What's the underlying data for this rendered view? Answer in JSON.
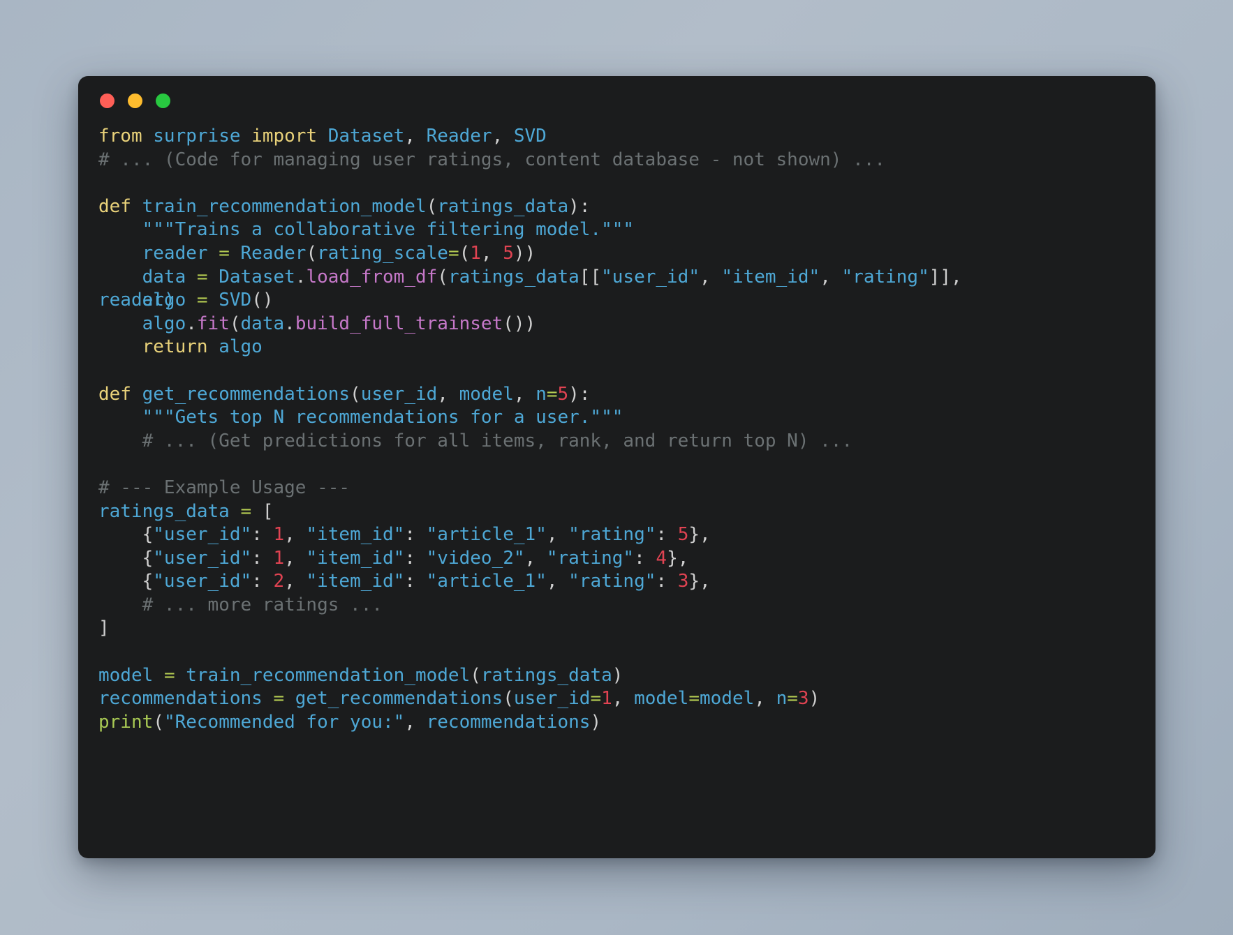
{
  "window": {
    "kind": "code-editor-window",
    "background_color": "#1b1c1d",
    "page_background": "#aab7c5",
    "traffic_lights": [
      {
        "name": "close",
        "label": "Close",
        "color": "#ff5f57"
      },
      {
        "name": "minimize",
        "label": "Minimize",
        "color": "#febc2e"
      },
      {
        "name": "maximize",
        "label": "Maximize",
        "color": "#28c840"
      }
    ]
  },
  "theme": {
    "keyword": "#e9d27a",
    "identifier": "#4ea8d6",
    "function": "#c678c9",
    "number": "#e04352",
    "string": "#4ea8d6",
    "comment": "#6b7173",
    "operator": "#b5cc52",
    "punctuation": "#d0d0d0",
    "builtin": "#a8c954"
  },
  "code": {
    "language": "python",
    "lines": [
      {
        "id": "l1",
        "text": "from surprise import Dataset, Reader, SVD"
      },
      {
        "id": "l2",
        "text": "# ... (Code for managing user ratings, content database - not shown) ..."
      },
      {
        "id": "l3",
        "text": ""
      },
      {
        "id": "l4",
        "text": "def train_recommendation_model(ratings_data):"
      },
      {
        "id": "l5",
        "text": "    \"\"\"Trains a collaborative filtering model.\"\"\""
      },
      {
        "id": "l6",
        "text": "    reader = Reader(rating_scale=(1, 5))"
      },
      {
        "id": "l7",
        "text": "    data = Dataset.load_from_df(ratings_data[[\"user_id\", \"item_id\", \"rating\"]], reader)"
      },
      {
        "id": "l8",
        "text": "    algo = SVD()"
      },
      {
        "id": "l9",
        "text": "    algo.fit(data.build_full_trainset())"
      },
      {
        "id": "l10",
        "text": "    return algo"
      },
      {
        "id": "l11",
        "text": ""
      },
      {
        "id": "l12",
        "text": "def get_recommendations(user_id, model, n=5):"
      },
      {
        "id": "l13",
        "text": "    \"\"\"Gets top N recommendations for a user.\"\"\""
      },
      {
        "id": "l14",
        "text": "    # ... (Get predictions for all items, rank, and return top N) ..."
      },
      {
        "id": "l15",
        "text": ""
      },
      {
        "id": "l16",
        "text": "# --- Example Usage ---"
      },
      {
        "id": "l17",
        "text": "ratings_data = ["
      },
      {
        "id": "l18",
        "text": "    {\"user_id\": 1, \"item_id\": \"article_1\", \"rating\": 5},"
      },
      {
        "id": "l19",
        "text": "    {\"user_id\": 1, \"item_id\": \"video_2\", \"rating\": 4},"
      },
      {
        "id": "l20",
        "text": "    {\"user_id\": 2, \"item_id\": \"article_1\", \"rating\": 3},"
      },
      {
        "id": "l21",
        "text": "    # ... more ratings ..."
      },
      {
        "id": "l22",
        "text": "]"
      },
      {
        "id": "l23",
        "text": ""
      },
      {
        "id": "l24",
        "text": "model = train_recommendation_model(ratings_data)"
      },
      {
        "id": "l25",
        "text": "recommendations = get_recommendations(user_id=1, model=model, n=3)"
      },
      {
        "id": "l26",
        "text": "print(\"Recommended for you:\", recommendations)"
      }
    ],
    "tokens": {
      "kw_from": "from",
      "mod_surprise": "surprise",
      "kw_import": "import",
      "imp_dataset": "Dataset",
      "imp_reader": "Reader",
      "imp_svd": "SVD",
      "comment_managing": "# ... (Code for managing user ratings, content database - not shown) ...",
      "kw_def": "def",
      "fn_train": "train_recommendation_model",
      "arg_ratings_data": "ratings_data",
      "doc_trains": "\"\"\"Trains a collaborative filtering model.\"\"\"",
      "var_reader": "reader",
      "cls_reader": "Reader",
      "kwarg_rating_scale": "rating_scale",
      "num_1": "1",
      "num_5": "5",
      "var_data": "data",
      "cls_dataset": "Dataset",
      "meth_load_from_df": "load_from_df",
      "str_user_id": "\"user_id\"",
      "str_item_id": "\"item_id\"",
      "str_rating": "\"rating\"",
      "wrap_reader": "reader)",
      "var_algo": "algo",
      "cls_svd": "SVD",
      "meth_fit": "fit",
      "meth_build_full_trainset": "build_full_trainset",
      "kw_return": "return",
      "fn_get_recommendations": "get_recommendations",
      "arg_user_id": "user_id",
      "arg_model": "model",
      "arg_n": "n",
      "doc_gets": "\"\"\"Gets top N recommendations for a user.\"\"\"",
      "comment_predictions": "# ... (Get predictions for all items, rank, and return top N) ...",
      "comment_example_usage": "# --- Example Usage ---",
      "str_article_1": "\"article_1\"",
      "str_video_2": "\"video_2\"",
      "num_4": "4",
      "num_3": "3",
      "num_2": "2",
      "comment_more_ratings": "# ... more ratings ...",
      "var_model": "model",
      "var_recommendations": "recommendations",
      "blt_print": "print",
      "str_recommended": "\"Recommended for you:\""
    }
  }
}
